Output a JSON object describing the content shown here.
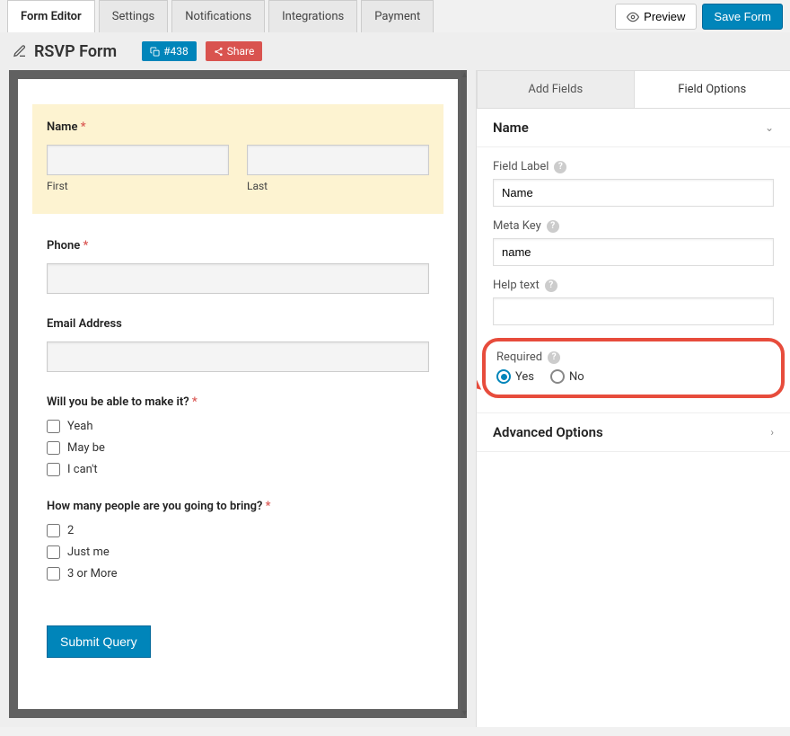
{
  "tabs": {
    "form_editor": "Form Editor",
    "settings": "Settings",
    "notifications": "Notifications",
    "integrations": "Integrations",
    "payment": "Payment"
  },
  "actions": {
    "preview": "Preview",
    "save": "Save Form"
  },
  "form": {
    "title": "RSVP Form",
    "id_badge": "#438",
    "share": "Share"
  },
  "fields": {
    "name": {
      "label": "Name",
      "first": "First",
      "last": "Last"
    },
    "phone": {
      "label": "Phone"
    },
    "email": {
      "label": "Email Address"
    },
    "attend": {
      "label": "Will you be able to make it?",
      "opts": [
        "Yeah",
        "May be",
        "I can't"
      ]
    },
    "guests": {
      "label": "How many people are you going to bring?",
      "opts": [
        "2",
        "Just me",
        "3 or More"
      ]
    },
    "submit": "Submit Query"
  },
  "sidebar": {
    "tabs": {
      "add": "Add Fields",
      "options": "Field Options"
    },
    "section_name": "Name",
    "field_label": {
      "label": "Field Label",
      "value": "Name"
    },
    "meta_key": {
      "label": "Meta Key",
      "value": "name"
    },
    "help_text": {
      "label": "Help text",
      "value": ""
    },
    "required": {
      "label": "Required",
      "yes": "Yes",
      "no": "No"
    },
    "advanced": "Advanced Options"
  }
}
